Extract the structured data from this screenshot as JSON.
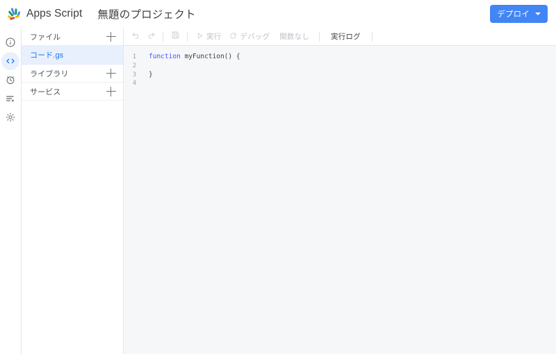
{
  "header": {
    "logo_icon": "apps-script-logo",
    "brand": "Apps Script",
    "project_title": "無題のプロジェクト",
    "deploy_label": "デプロイ",
    "deploy_caret_icon": "chevron-down-icon",
    "accent_color": "#4285f4"
  },
  "rail": {
    "items": [
      {
        "icon": "info-circle-icon",
        "name": "overview",
        "active": false
      },
      {
        "icon": "code-brackets-icon",
        "name": "editor",
        "active": true
      },
      {
        "icon": "alarm-clock-icon",
        "name": "triggers",
        "active": false
      },
      {
        "icon": "execution-list-icon",
        "name": "executions",
        "active": false
      },
      {
        "icon": "gear-icon",
        "name": "settings",
        "active": false
      }
    ]
  },
  "sidebar": {
    "sections": [
      {
        "label": "ファイル",
        "add_icon": "plus-icon"
      },
      {
        "label": "ライブラリ",
        "add_icon": "plus-icon"
      },
      {
        "label": "サービス",
        "add_icon": "plus-icon"
      }
    ],
    "files": [
      {
        "name": "コード.gs",
        "selected": true
      }
    ],
    "selected_bg": "#e8f0fe",
    "selected_fg": "#1a73e8"
  },
  "toolbar": {
    "undo_icon": "undo-arrow-icon",
    "redo_icon": "redo-arrow-icon",
    "save_icon": "save-floppy-icon",
    "run_icon": "play-triangle-icon",
    "run_label": "実行",
    "debug_icon": "debug-bug-icon",
    "debug_label": "デバッグ",
    "function_label": "関数なし",
    "log_label": "実行ログ"
  },
  "editor": {
    "background": "#f6f7f9",
    "lines": [
      {
        "number": "1",
        "keyword": "function",
        "rest": " myFunction() {"
      },
      {
        "number": "2",
        "keyword": "",
        "rest": ""
      },
      {
        "number": "3",
        "keyword": "",
        "rest": "}"
      },
      {
        "number": "4",
        "keyword": "",
        "rest": ""
      }
    ]
  }
}
